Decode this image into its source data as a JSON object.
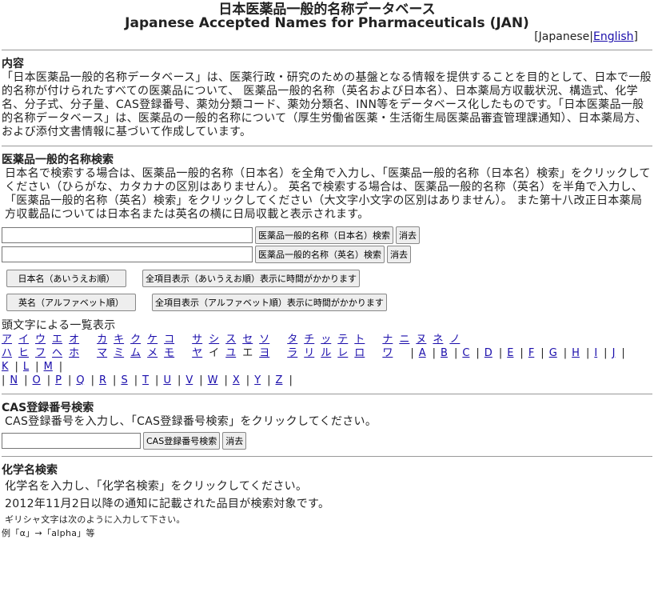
{
  "header": {
    "title_ja": "日本医薬品一般的名称データベース",
    "title_en": "Japanese Accepted Names for Pharmaceuticals (JAN)",
    "lang_current": "Japanese",
    "lang_link": "English"
  },
  "about": {
    "heading": "内容",
    "text": "「日本医薬品一般的名称データベース」は、医薬行政・研究のための基盤となる情報を提供することを目的として、日本で一般的名称が付けられたすべての医薬品について、 医薬品一般的名称（英名および日本名）、日本薬局方収載状況、構造式、化学名、分子式、分子量、CAS登録番号、薬効分類コード、薬効分類名、INN等をデータベース化したものです。「日本医薬品一般的名称データベース」は、医薬品の一般的名称について（厚生労働省医薬・生活衛生局医薬品審査管理課通知）、日本薬局方、および添付文書情報に基づいて作成しています。"
  },
  "name_search": {
    "heading": "医薬品一般的名称検索",
    "text": "日本名で検索する場合は、医薬品一般的名称（日本名）を全角で入力し、「医薬品一般的名称（日本名）検索」をクリックしてください（ひらがな、カタカナの区別はありません）。 英名で検索する場合は、医薬品一般的名称（英名）を半角で入力し、「医薬品一般的名称（英名）検索」をクリックしてください（大文字小文字の区別はありません）。 また第十八改正日本薬局方収載品については日本名または英名の横に日局収載と表示されます。",
    "ja_value": "",
    "en_value": "",
    "ja_button": "医薬品一般的名称（日本名）検索",
    "en_button": "医薬品一般的名称（英名）検索",
    "clear": "消去",
    "list_ja": "日本名（あいうえお順）",
    "list_ja_all": "全項目表示（あいうえお順）表示に時間がかかります",
    "list_en": "英名（アルファベット順）",
    "list_en_all": "全項目表示（アルファベット順）表示に時間がかかります"
  },
  "initials": {
    "heading": "頭文字による一覧表示",
    "kana_rows": [
      [
        [
          "ア",
          "イ",
          "ウ",
          "エ",
          "オ"
        ],
        [
          "カ",
          "キ",
          "ク",
          "ケ",
          "コ"
        ],
        [
          "サ",
          "シ",
          "ス",
          "セ",
          "ソ"
        ],
        [
          "タ",
          "チ",
          "ッ",
          "テ",
          "ト"
        ],
        [
          "ナ",
          "ニ",
          "ヌ",
          "ネ",
          "ノ"
        ]
      ],
      [
        [
          "ハ",
          "ヒ",
          "フ",
          "ヘ",
          "ホ"
        ],
        [
          "マ",
          "ミ",
          "ム",
          "メ",
          "モ"
        ],
        [
          "ヤ",
          "イ",
          "ユ",
          "エ",
          "ヨ"
        ],
        [
          "ラ",
          "リ",
          "ル",
          "レ",
          "ロ"
        ],
        [
          "ワ"
        ]
      ]
    ],
    "unlinked": [
      "ヤ-イ",
      "ヤ-エ"
    ],
    "letters": [
      "A",
      "B",
      "C",
      "D",
      "E",
      "F",
      "G",
      "H",
      "I",
      "J",
      "K",
      "L",
      "M",
      "N",
      "O",
      "P",
      "Q",
      "R",
      "S",
      "T",
      "U",
      "V",
      "W",
      "X",
      "Y",
      "Z"
    ]
  },
  "cas_search": {
    "heading": "CAS登録番号検索",
    "text": "CAS登録番号を入力し、「CAS登録番号検索」をクリックしてください。",
    "value": "",
    "button": "CAS登録番号検索",
    "clear": "消去"
  },
  "chem_search": {
    "heading": "化学名検索",
    "text1": "化学名を入力し、「化学名検索」をクリックしてください。",
    "text2": "2012年11月2日以降の通知に記載された品目が検索対象です。",
    "note": "ギリシャ文字は次のように入力して下さい。",
    "example": "例「α」→「alpha」等"
  }
}
